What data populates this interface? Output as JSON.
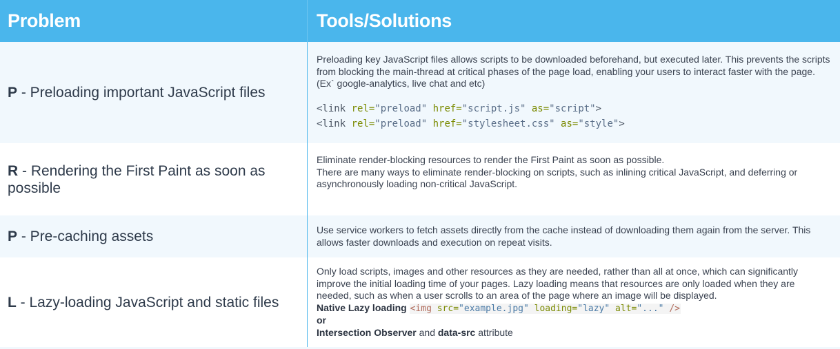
{
  "header": {
    "problem": "Problem",
    "solutions": "Tools/Solutions"
  },
  "rows": [
    {
      "letter": "P",
      "title": " - Preloading important JavaScript files",
      "desc": "Preloading key JavaScript files allows scripts to be downloaded beforehand, but executed later. This prevents the scripts from blocking the main-thread at critical phases of the page load, enabling your users to interact faster with the page. (Ex` google-analytics, live chat and etc)",
      "code": [
        {
          "open": "<link ",
          "a1": "rel=",
          "v1": "\"preload\"",
          "a2": " href=",
          "v2": "\"script.js\"",
          "a3": " as=",
          "v3": "\"script\"",
          "close": ">"
        },
        {
          "open": "<link ",
          "a1": "rel=",
          "v1": "\"preload\"",
          "a2": " href=",
          "v2": "\"stylesheet.css\"",
          "a3": " as=",
          "v3": "\"style\"",
          "close": ">"
        }
      ]
    },
    {
      "letter": "R",
      "title": " - Rendering the First Paint as soon as possible",
      "desc_line1": "Eliminate render-blocking resources to render the First Paint as soon as possible.",
      "desc_line2": "There are many ways to eliminate render-blocking on scripts, such as inlining critical JavaScript, and deferring or asynchronously loading non-critical JavaScript."
    },
    {
      "letter": "P",
      "title": " - Pre-caching assets",
      "desc": "Use service workers to fetch assets directly from the cache instead of downloading them again from the server. This allows faster downloads and execution on repeat visits."
    },
    {
      "letter": "L",
      "title": " - Lazy-loading JavaScript and static files",
      "desc": "Only load scripts, images and other resources as they are needed, rather than all at once, which can significantly improve the initial loading time of your pages. Lazy loading means that resources are only loaded when they are needed, such as when a user scrolls to an area of the page where an image will be displayed.",
      "native_label": "Native Lazy loading",
      "native_code": {
        "open": "<img ",
        "a1": "src=",
        "v1": "\"example.jpg\"",
        "a2": " loading=",
        "v2": "\"lazy\"",
        "a3": " alt=",
        "v3": "\"...\"",
        "close": " />"
      },
      "or": "or",
      "observer_label": "Intersection Observer",
      "and_text": " and ",
      "datasrc_label": "data-src",
      "attribute_text": " attribute"
    }
  ]
}
